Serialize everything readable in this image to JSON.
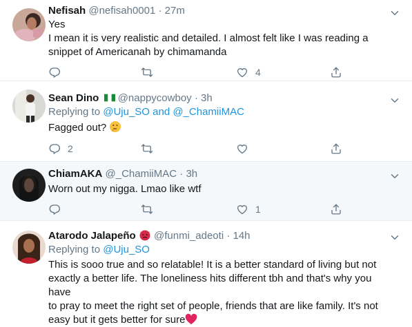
{
  "tweets": [
    {
      "name": "Nefisah",
      "handle": "@nefisah0001",
      "dot": "·",
      "time": "27m",
      "lines": [
        "Yes",
        "I mean it is very realistic and detailed. I almost felt like I was reading a",
        "snippet of Americanah by chimamanda"
      ],
      "reply_count": "",
      "like_count": "4"
    },
    {
      "name": "Sean Dino",
      "handle": "@nappycowboy",
      "dot": "·",
      "time": "3h",
      "replying_prefix": "Replying to ",
      "replying_to": "@Uju_SO and @_ChamiiMAC",
      "text": "Fagged out?",
      "reply_count": "2",
      "like_count": ""
    },
    {
      "name": "ChiamAKA",
      "handle": "@_ChamiiMAC",
      "dot": "·",
      "time": "3h",
      "text": "Worn out my nigga. Lmao like wtf",
      "reply_count": "",
      "like_count": "1"
    },
    {
      "name": "Atarodo Jalapeño",
      "handle": "@funmi_adeoti",
      "dot": "·",
      "time": "14h",
      "replying_prefix": "Replying to ",
      "replying_to": "@Uju_SO",
      "lines": [
        "This is sooo true and so relatable! It is a better standard of living but not",
        "exactly a better life. The loneliness hits different tbh and that's why you have",
        "to pray to meet the right set of people, friends that are like family. It's not",
        "easy but it gets better for sure"
      ]
    }
  ],
  "colors": {
    "accent": "#1b95e0",
    "muted": "#657786",
    "highlight_bg": "#f5f8fa",
    "heart": "#e0245e"
  },
  "icons": [
    "reply-icon",
    "retweet-icon",
    "like-icon",
    "share-icon",
    "chevron-down-icon",
    "nigeria-flag-icon",
    "thinking-face-icon",
    "angry-devil-icon",
    "red-heart-icon"
  ]
}
